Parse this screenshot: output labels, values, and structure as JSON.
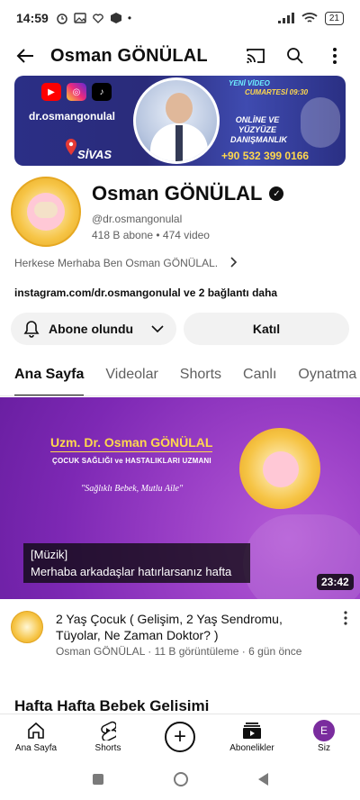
{
  "status_bar": {
    "time": "14:59",
    "battery": "21"
  },
  "header": {
    "title": "Osman GÖNÜLAL"
  },
  "banner": {
    "handle": "dr.osmangonulal",
    "city": "SİVAS",
    "new_video": "YENİ VİDEO",
    "schedule": "CUMARTESİ 09:30",
    "consult": "ONLİNE VE YÜZYÜZE DANIŞMANLIK",
    "phone": "+90 532 399 0166"
  },
  "channel": {
    "name": "Osman GÖNÜLAL",
    "handle": "@dr.osmangonulal",
    "stats": "418 B abone • 474 video",
    "description": "Herkese Merhaba Ben Osman GÖNÜLAL.",
    "links": "instagram.com/dr.osmangonulal ve 2 bağlantı daha",
    "subscribe_label": "Abone olundu",
    "join_label": "Katıl"
  },
  "tabs": [
    "Ana Sayfa",
    "Videolar",
    "Shorts",
    "Canlı",
    "Oynatma listeleri"
  ],
  "video": {
    "thumb_title": "Uzm. Dr. Osman GÖNÜLAL",
    "thumb_subtitle": "ÇOCUK SAĞLIĞI ve HASTALIKLARI UZMANI",
    "thumb_slogan": "\"Sağlıklı Bebek, Mutlu Aile\"",
    "caption_line1": "[Müzik]",
    "caption_line2": "Merhaba arkadaşlar hatırlarsanız hafta",
    "duration": "23:42",
    "title": "2 Yaş Çocuk ( Gelişim, 2 Yaş Sendromu, Tüyolar, Ne Zaman Doktor? )",
    "meta": "Osman GÖNÜLAL · 11 B görüntüleme · 6 gün önce"
  },
  "section": {
    "title": "Hafta Hafta Bebek Gelisimi"
  },
  "bottom_nav": {
    "home": "Ana Sayfa",
    "shorts": "Shorts",
    "subscriptions": "Abonelikler",
    "you": "Siz",
    "avatar_letter": "E"
  },
  "colors": {
    "accent_yellow": "#ffd84d",
    "banner_bg": "#2b2f86",
    "thumb_bg": "#8a36be"
  }
}
